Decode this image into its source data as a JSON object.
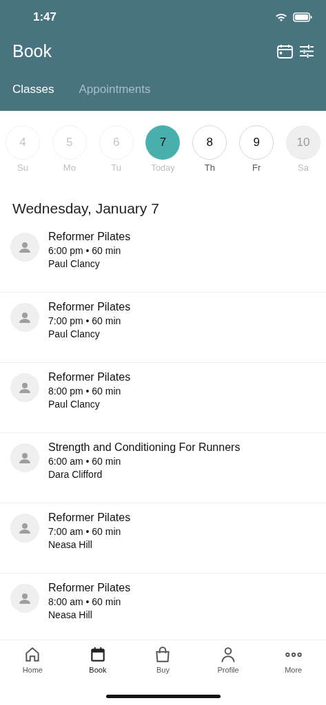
{
  "status_bar": {
    "time": "1:47"
  },
  "header": {
    "title": "Book"
  },
  "tabs": [
    {
      "label": "Classes",
      "selected": true
    },
    {
      "label": "Appointments",
      "selected": false
    }
  ],
  "days": [
    {
      "number": "4",
      "label": "Su",
      "kind": "past",
      "selected": false
    },
    {
      "number": "5",
      "label": "Mo",
      "kind": "past",
      "selected": false
    },
    {
      "number": "6",
      "label": "Tu",
      "kind": "past",
      "selected": false
    },
    {
      "number": "7",
      "label": "Today",
      "kind": "past",
      "selected": true
    },
    {
      "number": "8",
      "label": "Th",
      "kind": "future",
      "selected": false
    },
    {
      "number": "9",
      "label": "Fr",
      "kind": "future",
      "selected": false
    },
    {
      "number": "10",
      "label": "Sa",
      "kind": "unavailable",
      "selected": false
    }
  ],
  "date_heading": "Wednesday, January 7",
  "classes": [
    {
      "name": "Reformer Pilates",
      "time": "6:00 pm • 60 min",
      "instructor": "Paul Clancy"
    },
    {
      "name": "Reformer Pilates",
      "time": "7:00 pm • 60 min",
      "instructor": "Paul Clancy"
    },
    {
      "name": "Reformer Pilates",
      "time": "8:00 pm • 60 min",
      "instructor": "Paul Clancy"
    },
    {
      "name": "Strength and Conditioning For Runners",
      "time": "6:00 am • 60 min",
      "instructor": "Dara Clifford"
    },
    {
      "name": "Reformer Pilates",
      "time": "7:00 am • 60 min",
      "instructor": "Neasa Hill"
    },
    {
      "name": "Reformer Pilates",
      "time": "8:00 am • 60 min",
      "instructor": "Neasa Hill"
    }
  ],
  "nav": [
    {
      "label": "Home",
      "kind": "home",
      "selected": false
    },
    {
      "label": "Book",
      "kind": "book",
      "selected": true
    },
    {
      "label": "Buy",
      "kind": "buy",
      "selected": false
    },
    {
      "label": "Profile",
      "kind": "profile",
      "selected": false
    },
    {
      "label": "More",
      "kind": "more",
      "selected": false
    }
  ]
}
